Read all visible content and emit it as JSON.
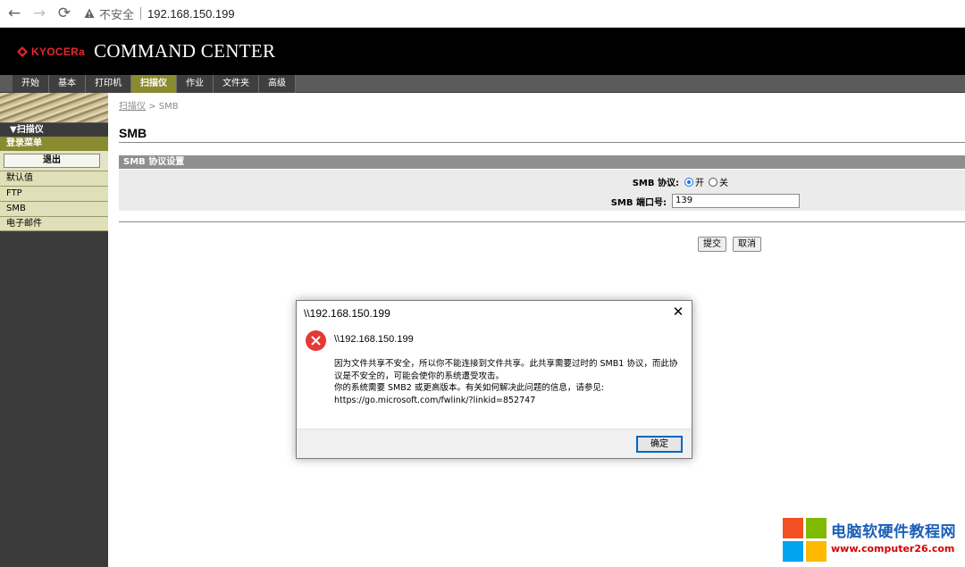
{
  "browser": {
    "insecure_label": "不安全",
    "url": "192.168.150.199"
  },
  "header": {
    "logo_text": "KYOCERa",
    "title": "COMMAND CENTER"
  },
  "tabs": [
    {
      "label": "开始"
    },
    {
      "label": "基本"
    },
    {
      "label": "打印机"
    },
    {
      "label": "扫描仪"
    },
    {
      "label": "作业"
    },
    {
      "label": "文件夹"
    },
    {
      "label": "高级"
    }
  ],
  "sidebar": {
    "section": "▼扫描仪",
    "login_menu": "登录菜单",
    "logout": "退出",
    "items": [
      {
        "label": "默认值"
      },
      {
        "label": "FTP"
      },
      {
        "label": "SMB"
      },
      {
        "label": "电子邮件"
      }
    ]
  },
  "main": {
    "breadcrumb_link": "扫描仪",
    "breadcrumb_sep": ">",
    "breadcrumb_current": "SMB",
    "title": "SMB",
    "section_header": "SMB 协议设置",
    "protocol_label": "SMB 协议:",
    "radio_on": "开",
    "radio_off": "关",
    "port_label": "SMB 端口号:",
    "port_value": "139",
    "submit": "提交",
    "cancel": "取消"
  },
  "dialog": {
    "title": "\\\\192.168.150.199",
    "path": "\\\\192.168.150.199",
    "message_line1": "因为文件共享不安全，所以你不能连接到文件共享。此共享需要过时的 SMB1 协议，而此协",
    "message_line2": "议是不安全的，可能会使你的系统遭受攻击。",
    "message_line3": "你的系统需要 SMB2 或更高版本。有关如何解决此问题的信息，请参见:",
    "message_line4": "https://go.microsoft.com/fwlink/?linkid=852747",
    "ok": "确定"
  },
  "watermark": {
    "title": "电脑软硬件教程网",
    "url": "www.computer26.com"
  },
  "colors": {
    "tab_active": "#8a8a30",
    "sidebar_bg": "#3b3b3b",
    "sidebar_item": "#e0e0b8",
    "error_red": "#e53935",
    "ok_border": "#0067c0"
  }
}
